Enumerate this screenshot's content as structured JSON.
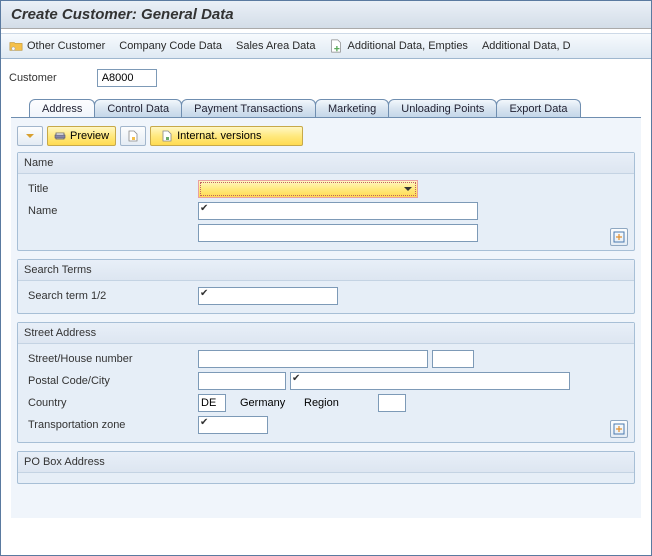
{
  "window": {
    "title": "Create Customer: General Data"
  },
  "main_toolbar": {
    "other_customer": "Other Customer",
    "company_code": "Company Code Data",
    "sales_area": "Sales Area Data",
    "addl_empties": "Additional Data, Empties",
    "addl_d": "Additional Data, D"
  },
  "header": {
    "label": "Customer",
    "value": "A8000"
  },
  "tabs": {
    "address": "Address",
    "control": "Control Data",
    "payment": "Payment Transactions",
    "marketing": "Marketing",
    "unloading": "Unloading Points",
    "export": "Export Data"
  },
  "inner_tb": {
    "preview": "Preview",
    "internat": "Internat. versions"
  },
  "groups": {
    "name": {
      "title": "Name",
      "row_title": "Title",
      "row_name": "Name"
    },
    "search": {
      "title": "Search Terms",
      "row_term": "Search term 1/2"
    },
    "street": {
      "title": "Street Address",
      "row_street": "Street/House number",
      "row_postal": "Postal Code/City",
      "row_country": "Country",
      "country_code": "DE",
      "country_name": "Germany",
      "region_label": "Region",
      "row_tz": "Transportation zone"
    },
    "pobox": {
      "title": "PO Box Address"
    }
  }
}
